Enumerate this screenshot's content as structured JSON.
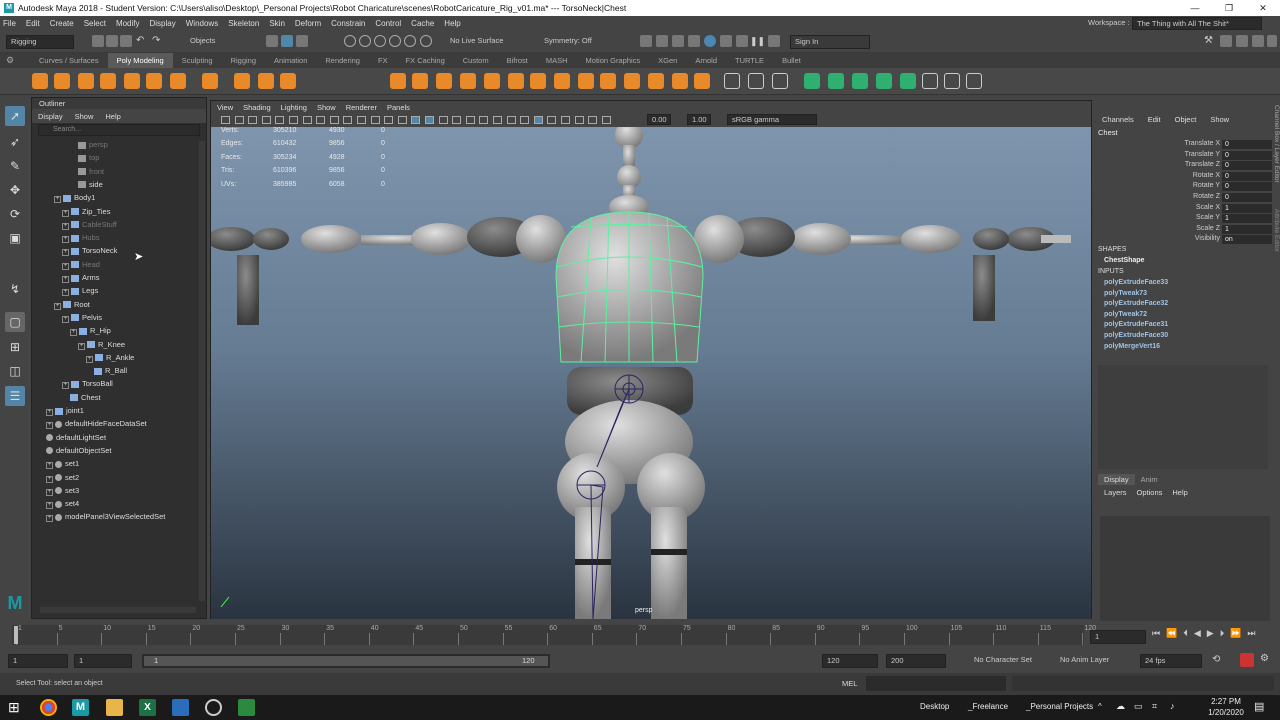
{
  "window": {
    "title": "Autodesk Maya 2018 - Student Version: C:\\Users\\aliso\\Desktop\\_Personal Projects\\Robot Charicature\\scenes\\RobotCaricature_Rig_v01.ma*  ---  TorsoNeck|Chest",
    "controls": [
      "—",
      "❐",
      "✕"
    ]
  },
  "menubar": [
    "File",
    "Edit",
    "Create",
    "Select",
    "Modify",
    "Display",
    "Windows",
    "Skeleton",
    "Skin",
    "Deform",
    "Constrain",
    "Control",
    "Cache",
    "Help"
  ],
  "workspace": {
    "label": "Workspace :",
    "value": "The Thing with All The Shit*"
  },
  "toolbar": {
    "menuset": "Rigging",
    "objects": "Objects",
    "live_surface": "No Live Surface",
    "symmetry": "Symmetry: Off",
    "sign_in": "Sign In"
  },
  "shelf_tabs": [
    "Curves / Surfaces",
    "Poly Modeling",
    "Sculpting",
    "Rigging",
    "Animation",
    "Rendering",
    "FX",
    "FX Caching",
    "Custom",
    "Bifrost",
    "MASH",
    "Motion Graphics",
    "XGen",
    "Arnold",
    "TURTLE",
    "Bullet"
  ],
  "shelf_active": "Poly Modeling",
  "outliner": {
    "title": "Outliner",
    "menu": [
      "Display",
      "Show",
      "Help"
    ],
    "search_placeholder": "Search...",
    "items": [
      {
        "label": "persp",
        "dim": true,
        "icon": "camera-icon"
      },
      {
        "label": "top",
        "dim": true,
        "icon": "camera-icon"
      },
      {
        "label": "front",
        "dim": true,
        "icon": "camera-icon"
      },
      {
        "label": "side",
        "dim": false,
        "icon": "camera-icon"
      },
      {
        "label": "Body1",
        "dim": false,
        "icon": "group-icon"
      },
      {
        "label": "Zip_Ties",
        "dim": false,
        "icon": "group-icon"
      },
      {
        "label": "CableStuff",
        "dim": true,
        "icon": "group-icon"
      },
      {
        "label": "Hubs",
        "dim": true,
        "icon": "group-icon"
      },
      {
        "label": "TorsoNeck",
        "dim": false,
        "icon": "group-icon"
      },
      {
        "label": "Head",
        "dim": true,
        "icon": "group-icon"
      },
      {
        "label": "Arms",
        "dim": false,
        "icon": "group-icon"
      },
      {
        "label": "Legs",
        "dim": false,
        "icon": "group-icon"
      },
      {
        "label": "Root",
        "dim": false,
        "icon": "joint-icon"
      },
      {
        "label": "Pelvis",
        "dim": false,
        "icon": "joint-icon"
      },
      {
        "label": "R_Hip",
        "dim": false,
        "icon": "joint-icon"
      },
      {
        "label": "R_Knee",
        "dim": false,
        "icon": "joint-icon"
      },
      {
        "label": "R_Ankle",
        "dim": false,
        "icon": "joint-icon"
      },
      {
        "label": "R_Ball",
        "dim": false,
        "icon": "joint-icon"
      },
      {
        "label": "TorsoBall",
        "dim": false,
        "icon": "joint-icon"
      },
      {
        "label": "Chest",
        "dim": false,
        "icon": "joint-icon"
      },
      {
        "label": "joint1",
        "dim": false,
        "icon": "joint-icon"
      },
      {
        "label": "defaultHideFaceDataSet",
        "dim": false,
        "icon": "set-icon"
      },
      {
        "label": "defaultLightSet",
        "dim": false,
        "icon": "set-icon"
      },
      {
        "label": "defaultObjectSet",
        "dim": false,
        "icon": "set-icon"
      },
      {
        "label": "set1",
        "dim": false,
        "icon": "set-icon"
      },
      {
        "label": "set2",
        "dim": false,
        "icon": "set-icon"
      },
      {
        "label": "set3",
        "dim": false,
        "icon": "set-icon"
      },
      {
        "label": "set4",
        "dim": false,
        "icon": "set-icon"
      },
      {
        "label": "modelPanel3ViewSelectedSet",
        "dim": false,
        "icon": "set-icon"
      }
    ]
  },
  "viewport": {
    "menu": [
      "View",
      "Shading",
      "Lighting",
      "Show",
      "Renderer",
      "Panels"
    ],
    "near_value": "0.00",
    "far_value": "1.00",
    "color_space": "sRGB gamma",
    "camera_label": "persp",
    "hud": [
      {
        "label": "Verts:",
        "a": "305210",
        "b": "4930",
        "c": "0"
      },
      {
        "label": "Edges:",
        "a": "610432",
        "b": "9856",
        "c": "0"
      },
      {
        "label": "Faces:",
        "a": "305234",
        "b": "4928",
        "c": "0"
      },
      {
        "label": "Tris:",
        "a": "610396",
        "b": "9856",
        "c": "0"
      },
      {
        "label": "UVs:",
        "a": "385985",
        "b": "6058",
        "c": "0"
      }
    ]
  },
  "channelbox": {
    "menu": [
      "Channels",
      "Edit",
      "Object",
      "Show"
    ],
    "object": "Chest",
    "attributes": [
      {
        "name": "Translate X",
        "value": "0"
      },
      {
        "name": "Translate Y",
        "value": "0"
      },
      {
        "name": "Translate Z",
        "value": "0"
      },
      {
        "name": "Rotate X",
        "value": "0"
      },
      {
        "name": "Rotate Y",
        "value": "0"
      },
      {
        "name": "Rotate Z",
        "value": "0"
      },
      {
        "name": "Scale X",
        "value": "1"
      },
      {
        "name": "Scale Y",
        "value": "1"
      },
      {
        "name": "Scale Z",
        "value": "1"
      },
      {
        "name": "Visibility",
        "value": "on"
      }
    ],
    "shapes_label": "SHAPES",
    "shape": "ChestShape",
    "inputs_label": "INPUTS",
    "inputs": [
      "polyExtrudeFace33",
      "polyTweak73",
      "polyExtrudeFace32",
      "polyTweak72",
      "polyExtrudeFace31",
      "polyExtrudeFace30",
      "polyMergeVert16"
    ],
    "side_tabs": [
      "Channel Box / Layer Editor",
      "Attribute Editor"
    ]
  },
  "layer_editor": {
    "tabs": [
      "Display",
      "Anim"
    ],
    "menu": [
      "Layers",
      "Options",
      "Help"
    ]
  },
  "timeline": {
    "ticks": [
      "1",
      "5",
      "10",
      "15",
      "20",
      "25",
      "30",
      "35",
      "40",
      "45",
      "50",
      "55",
      "60",
      "65",
      "70",
      "75",
      "80",
      "85",
      "90",
      "95",
      "100",
      "105",
      "110",
      "115",
      "120"
    ],
    "current_frame": "1",
    "range_start": "1",
    "range_start2": "1",
    "slider_start": "1",
    "slider_end": "120",
    "anim_end": "120",
    "anim_end2": "200",
    "character_set": "No Character Set",
    "anim_layer": "No Anim Layer",
    "fps": "24 fps"
  },
  "commandline": {
    "status": "Select Tool: select an object",
    "mode": "MEL"
  },
  "taskbar": {
    "items": [
      "Desktop",
      "_Freelance",
      "_Personal Projects"
    ],
    "time": "2:27 PM",
    "date": "1/20/2020"
  },
  "colors": {
    "accent": "#5285a6",
    "wire": "#5ef0a0",
    "maya_teal": "#1a9aa5"
  }
}
